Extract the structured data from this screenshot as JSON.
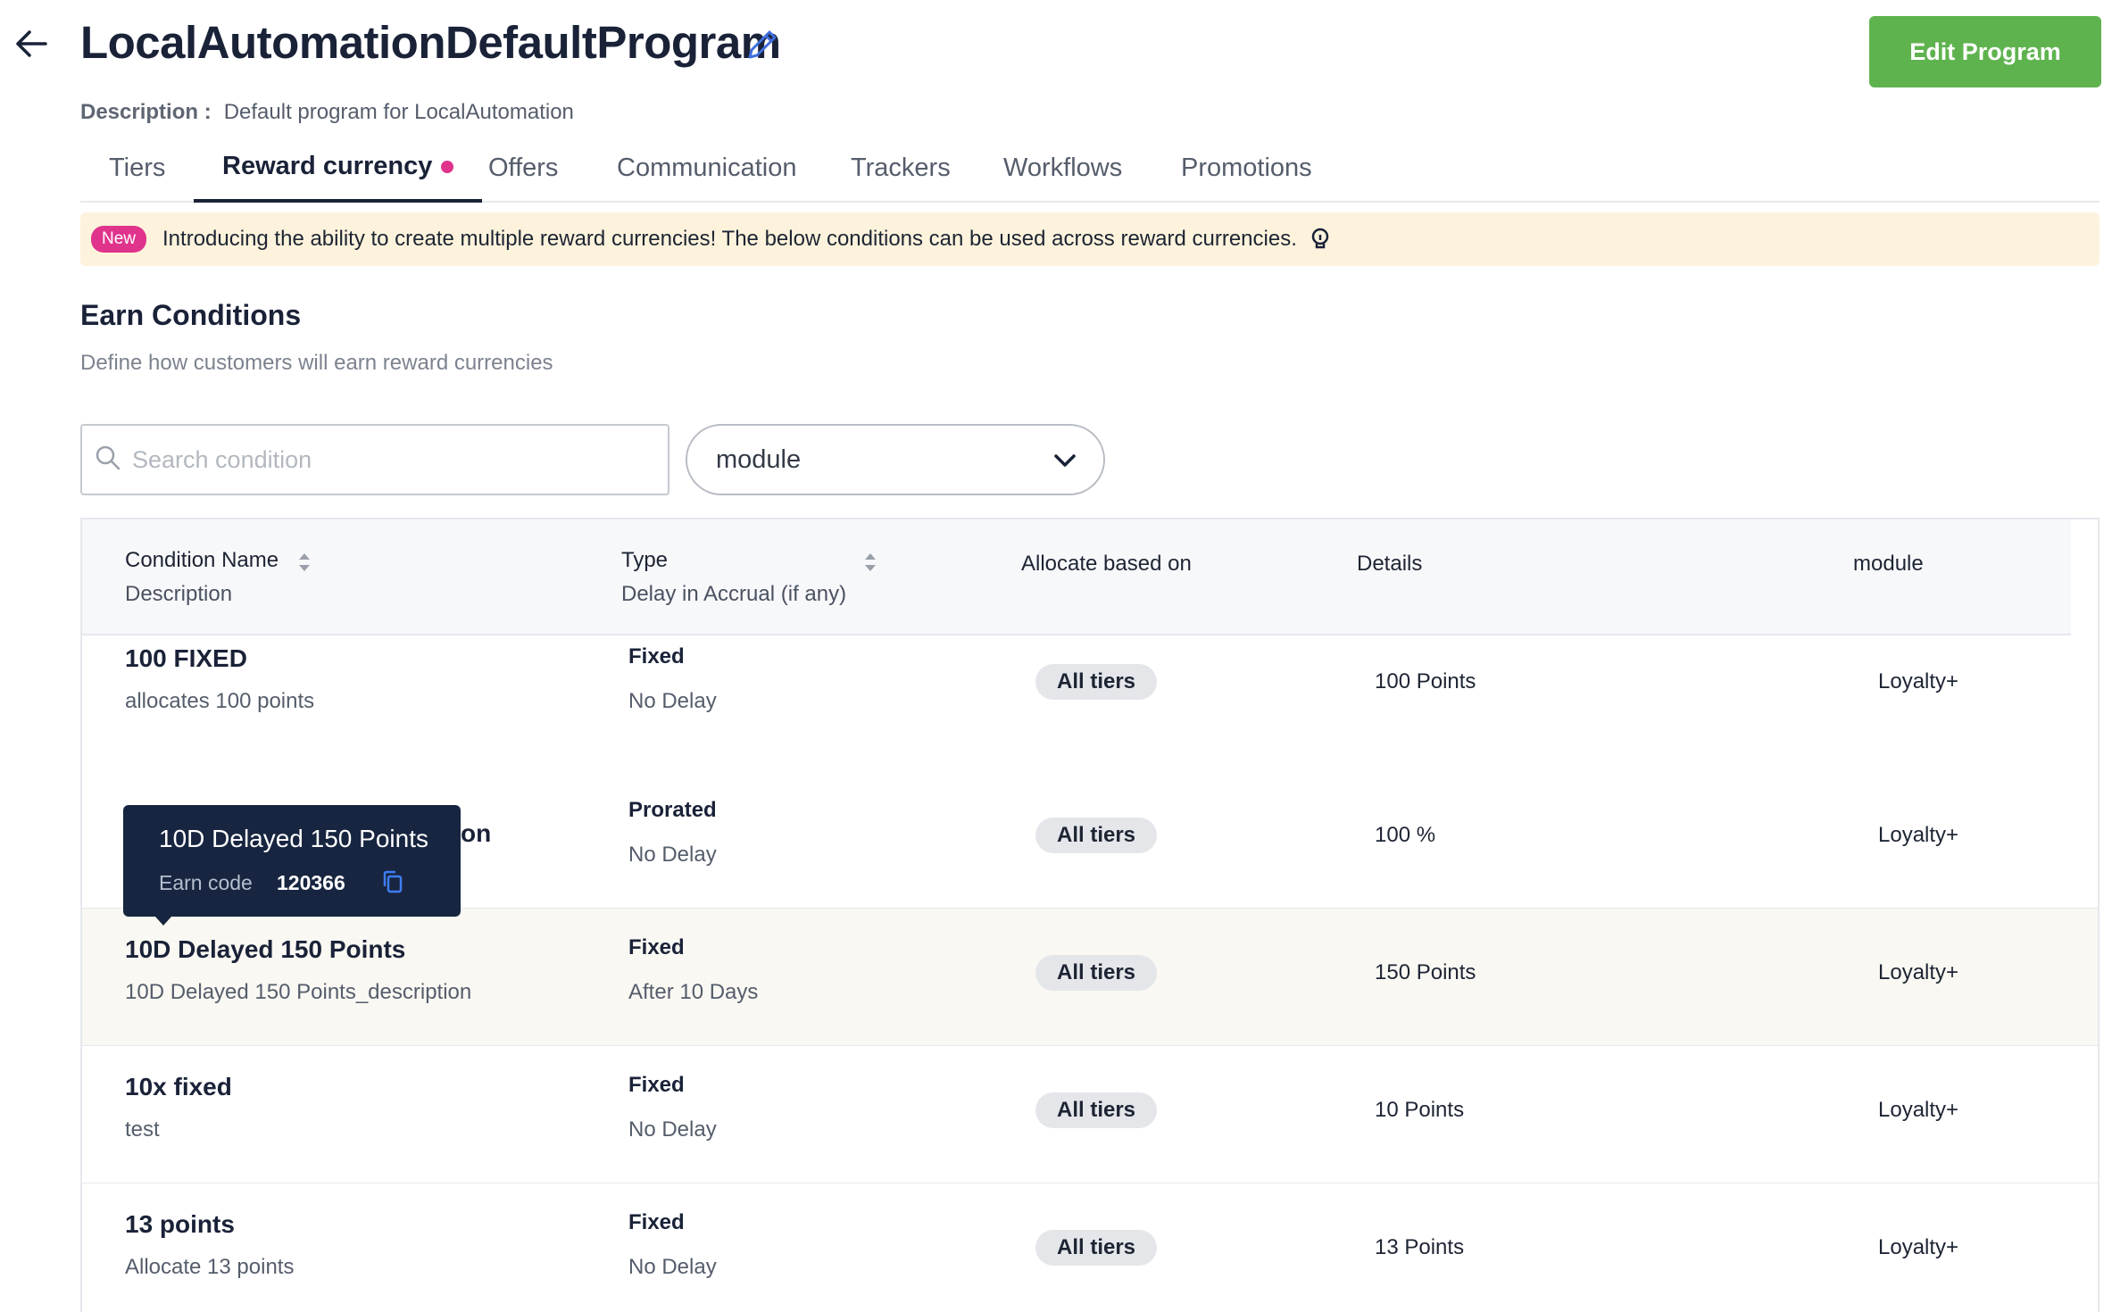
{
  "header": {
    "title": "LocalAutomationDefaultProgram",
    "edit_button": "Edit Program",
    "description_label": "Description :",
    "description_value": "Default program for LocalAutomation"
  },
  "tabs": [
    {
      "label": "Tiers"
    },
    {
      "label": "Reward currency",
      "active": true
    },
    {
      "label": "Offers"
    },
    {
      "label": "Communication"
    },
    {
      "label": "Trackers"
    },
    {
      "label": "Workflows"
    },
    {
      "label": "Promotions"
    }
  ],
  "banner": {
    "badge": "New",
    "text": "Introducing the ability to create multiple reward currencies! The below conditions can be used across reward currencies."
  },
  "section": {
    "title": "Earn Conditions",
    "subtitle": "Define how customers will earn reward currencies"
  },
  "filters": {
    "search_placeholder": "Search condition",
    "module_value": "module"
  },
  "table": {
    "headers": {
      "name": "Condition Name",
      "name_sub": "Description",
      "type": "Type",
      "type_sub": "Delay in Accrual (if any)",
      "allocate": "Allocate based on",
      "details": "Details",
      "module": "module"
    },
    "rows": [
      {
        "name": "100 FIXED",
        "description": "allocates 100 points",
        "type": "Fixed",
        "delay": "No Delay",
        "allocate": "All tiers",
        "details": "100 Points",
        "module": "Loyalty+"
      },
      {
        "name": "",
        "description": "",
        "type": "Prorated",
        "delay": "No Delay",
        "allocate": "All tiers",
        "details": "100 %",
        "module": "Loyalty+"
      },
      {
        "name": "10D Delayed 150 Points",
        "description": "10D Delayed 150 Points_description",
        "type": "Fixed",
        "delay": "After 10 Days",
        "allocate": "All tiers",
        "details": "150 Points",
        "module": "Loyalty+"
      },
      {
        "name": "10x fixed",
        "description": "test",
        "type": "Fixed",
        "delay": "No Delay",
        "allocate": "All tiers",
        "details": "10 Points",
        "module": "Loyalty+"
      },
      {
        "name": "13 points",
        "description": "Allocate 13 points",
        "type": "Fixed",
        "delay": "No Delay",
        "allocate": "All tiers",
        "details": "13 Points",
        "module": "Loyalty+"
      }
    ]
  },
  "tooltip": {
    "title": "10D Delayed 150 Points",
    "code_label": "Earn code",
    "code_value": "120366",
    "hidden_tail": "on"
  },
  "colors": {
    "primary_text": "#1a2238",
    "edit_button": "#5fb34f",
    "new_badge": "#e0338c",
    "banner_bg": "#fdf3dc",
    "tooltip_bg": "#172540",
    "copy_icon": "#3f7df2"
  }
}
